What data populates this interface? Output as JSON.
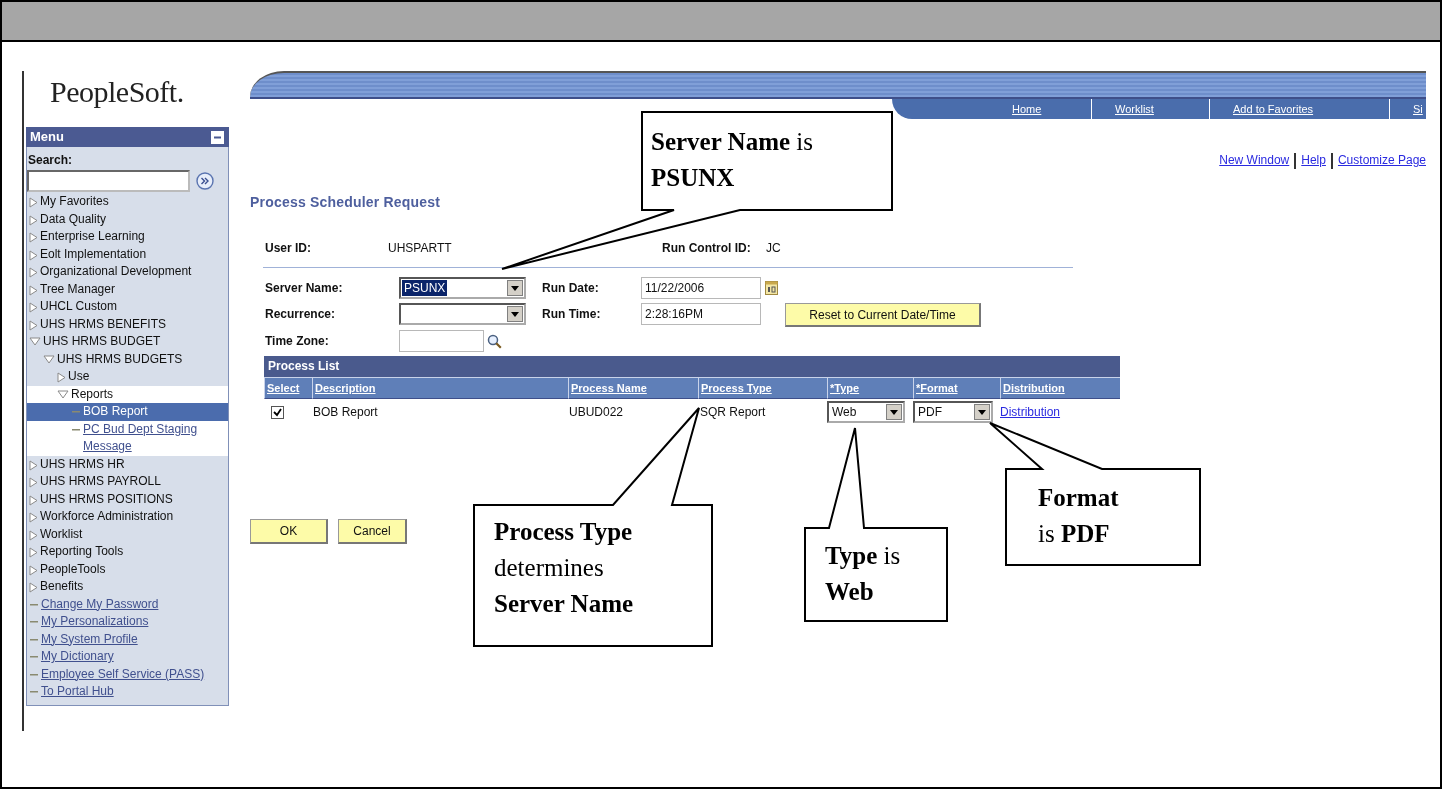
{
  "logo": "PeopleSoft.",
  "nav_links": [
    "Home",
    "Worklist",
    "Add to Favorites",
    "Si"
  ],
  "menu": {
    "title": "Menu",
    "search_label": "Search:",
    "items": [
      {
        "label": "My Favorites",
        "kind": "folder",
        "expanded": false,
        "selected": false
      },
      {
        "label": "Data Quality",
        "kind": "folder",
        "expanded": false,
        "selected": false
      },
      {
        "label": "Enterprise Learning",
        "kind": "folder",
        "expanded": false,
        "selected": false
      },
      {
        "label": "Eolt Implementation",
        "kind": "folder",
        "expanded": false,
        "selected": false
      },
      {
        "label": "Organizational Development",
        "kind": "folder",
        "expanded": false,
        "selected": false
      },
      {
        "label": "Tree Manager",
        "kind": "folder",
        "expanded": false,
        "selected": false
      },
      {
        "label": "UHCL Custom",
        "kind": "folder",
        "expanded": false,
        "selected": false
      },
      {
        "label": "UHS HRMS BENEFITS",
        "kind": "folder",
        "expanded": false,
        "selected": false
      },
      {
        "label": "UHS HRMS BUDGET",
        "kind": "folder",
        "expanded": true,
        "selected": false,
        "children": [
          {
            "label": "UHS HRMS BUDGETS",
            "kind": "folder",
            "expanded": true,
            "selected": false,
            "children": [
              {
                "label": "Use",
                "kind": "folder",
                "expanded": false,
                "selected": false
              },
              {
                "label": "Reports",
                "kind": "folder",
                "expanded": true,
                "selected": false,
                "children": [
                  {
                    "label": "BOB Report",
                    "kind": "link",
                    "selected": true
                  },
                  {
                    "label": "PC Bud Dept Staging Message",
                    "kind": "link",
                    "selected": false
                  }
                ]
              }
            ]
          }
        ]
      },
      {
        "label": "UHS HRMS HR",
        "kind": "folder",
        "expanded": false,
        "selected": false
      },
      {
        "label": "UHS HRMS PAYROLL",
        "kind": "folder",
        "expanded": false,
        "selected": false
      },
      {
        "label": "UHS HRMS POSITIONS",
        "kind": "folder",
        "expanded": false,
        "selected": false
      },
      {
        "label": "Workforce Administration",
        "kind": "folder",
        "expanded": false,
        "selected": false
      },
      {
        "label": "Worklist",
        "kind": "folder",
        "expanded": false,
        "selected": false
      },
      {
        "label": "Reporting Tools",
        "kind": "folder",
        "expanded": false,
        "selected": false
      },
      {
        "label": "PeopleTools",
        "kind": "folder",
        "expanded": false,
        "selected": false
      },
      {
        "label": "Benefits",
        "kind": "folder",
        "expanded": false,
        "selected": false
      },
      {
        "label": "Change My Password",
        "kind": "link",
        "selected": false
      },
      {
        "label": "My Personalizations",
        "kind": "link",
        "selected": false
      },
      {
        "label": "My System Profile",
        "kind": "link",
        "selected": false
      },
      {
        "label": "My Dictionary",
        "kind": "link",
        "selected": false
      },
      {
        "label": "Employee Self Service (PASS)",
        "kind": "link",
        "selected": false
      },
      {
        "label": "To Portal Hub",
        "kind": "link",
        "selected": false
      }
    ]
  },
  "page_links": [
    "New Window",
    "Help",
    "Customize Page"
  ],
  "page_title": "Process Scheduler Request",
  "header_fields": [
    {
      "label": "User ID:",
      "value": "UHSPARTT"
    },
    {
      "label": "Run Control ID:",
      "value": "JC"
    }
  ],
  "server_name": {
    "label": "Server Name:",
    "value": "PSUNX",
    "focused": true
  },
  "recurrence": {
    "label": "Recurrence:"
  },
  "run_date": {
    "label": "Run Date:",
    "value": "11/22/2006"
  },
  "run_time": {
    "label": "Run Time:",
    "value": "2:28:16PM"
  },
  "reset_button": "Reset to Current Date/Time",
  "time_zone": {
    "label": "Time Zone:"
  },
  "process_list": {
    "title": "Process List",
    "columns": [
      "Select",
      "Description",
      "Process Name",
      "Process Type",
      "*Type",
      "*Format",
      "Distribution"
    ],
    "rows": [
      {
        "checked": true,
        "description": "BOB Report",
        "process_name": "UBUD022",
        "process_type": "SQR Report",
        "type": "Web",
        "format": "PDF",
        "distribution": "Distribution"
      }
    ]
  },
  "buttons": [
    "OK",
    "Cancel"
  ],
  "callouts": [
    {
      "lines": [
        "**Server Name** is",
        "**PSUNX**"
      ]
    },
    {
      "lines": [
        "**Process Type**",
        "determines",
        "**Server Name**"
      ]
    },
    {
      "lines": [
        "**Type** is",
        "**Web**"
      ]
    },
    {
      "lines": [
        "**Format**",
        "is **PDF**"
      ]
    }
  ]
}
